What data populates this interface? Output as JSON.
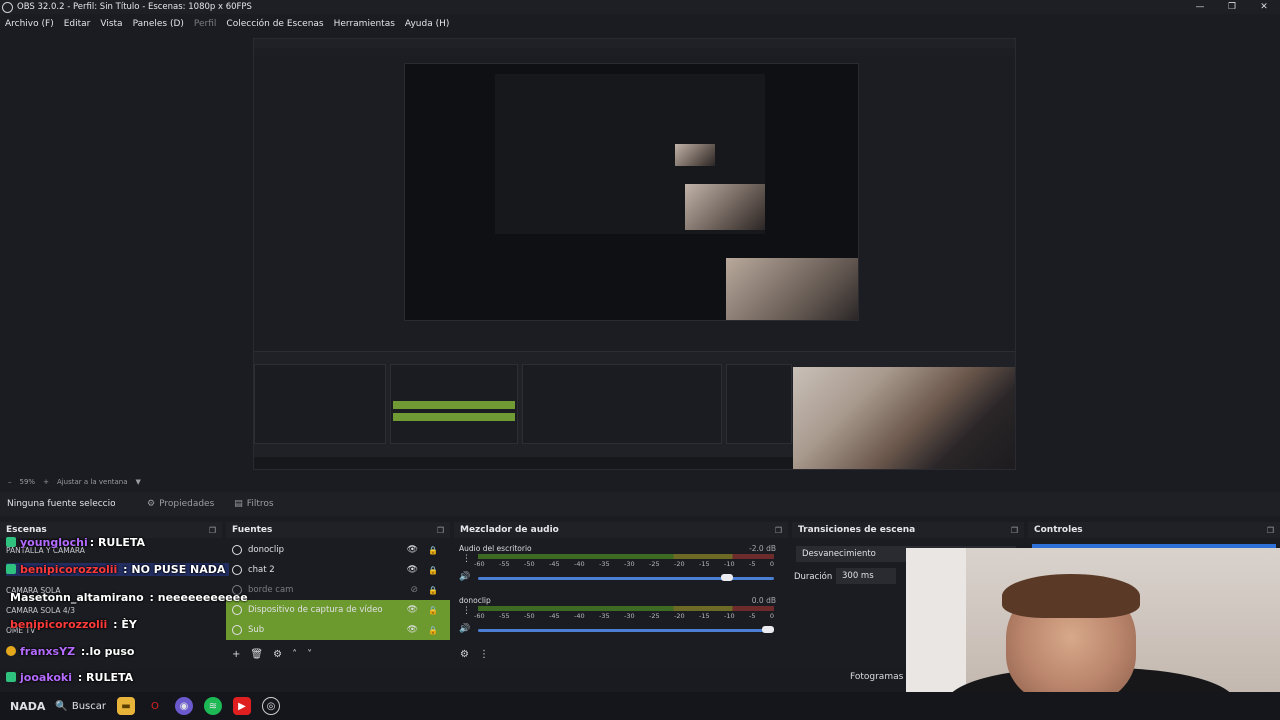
{
  "window": {
    "title": "OBS 32.0.2 - Perfil: Sin Título - Escenas: 1080p x 60FPS",
    "controls": [
      "—",
      "❐",
      "✕"
    ]
  },
  "menu": {
    "items": [
      {
        "label": "Archivo (F)",
        "disabled": false
      },
      {
        "label": "Editar",
        "disabled": false
      },
      {
        "label": "Vista",
        "disabled": false
      },
      {
        "label": "Paneles (D)",
        "disabled": false
      },
      {
        "label": "Perfil",
        "disabled": true
      },
      {
        "label": "Colección de Escenas",
        "disabled": false
      },
      {
        "label": "Herramientas",
        "disabled": false
      },
      {
        "label": "Ayuda (H)",
        "disabled": false
      }
    ]
  },
  "zoom": {
    "minus": "–",
    "value": "59%",
    "plus": "+",
    "fit": "Ajustar a la ventana",
    "dropdown": "▼"
  },
  "source_toolbar": {
    "no_source": "Ninguna fuente seleccionada",
    "properties": "Propiedades",
    "filters": "Filtros"
  },
  "docks": {
    "scenes": {
      "title": "Escenas",
      "items": [
        "PANTALLA Y CAMARA",
        "CAMARA SOLA",
        "CAMARA SOLA 4/3",
        "OME TV"
      ]
    },
    "sources": {
      "title": "Fuentes",
      "items": [
        {
          "name": "donoclip",
          "selected": false,
          "hidden": false
        },
        {
          "name": "chat 2",
          "selected": false,
          "hidden": false
        },
        {
          "name": "borde cam",
          "selected": false,
          "hidden": true
        },
        {
          "name": "Dispositivo de captura de vídeo",
          "selected": true,
          "hidden": false
        },
        {
          "name": "Sub",
          "selected": true,
          "hidden": false
        }
      ]
    },
    "mixer": {
      "title": "Mezclador de audio",
      "scale": [
        "-60",
        "-55",
        "-50",
        "-45",
        "-40",
        "-35",
        "-30",
        "-25",
        "-20",
        "-15",
        "-10",
        "-5",
        "0"
      ],
      "channels": [
        {
          "name": "Audio del escritorio",
          "db": "-2.0 dB",
          "level": 0.86
        },
        {
          "name": "donoclip",
          "db": "0.0 dB",
          "level": 1.0
        }
      ]
    },
    "transitions": {
      "title": "Transiciones de escena",
      "selected": "Desvanecimiento",
      "duration_label": "Duración",
      "duration_value": "300 ms"
    },
    "controls": {
      "title": "Controles"
    }
  },
  "status": {
    "fps_label": "Fotogramas P"
  },
  "chat": [
    {
      "user": "younglochi",
      "msg": ": RULETA",
      "badge": "green",
      "user_color": "#b46bff"
    },
    {
      "user": "benipicorozzolii",
      "msg": " : NO PUSE NADA",
      "badge": "green",
      "user_color": "#ff3a3a"
    },
    {
      "user": "Masetonn_altamirano",
      "msg": " : neeeeeeeeeee",
      "badge": "",
      "user_color": "#ffffff"
    },
    {
      "user": "benipicorozzolii",
      "msg": " : ÈY",
      "badge": "",
      "user_color": "#ff3a3a"
    },
    {
      "user": "franxsYZ",
      "msg": " :.lo puso",
      "badge": "gold",
      "user_color": "#b46bff"
    },
    {
      "user": "jooakoki",
      "msg": " : RULETA",
      "badge": "green",
      "user_color": "#b46bff"
    }
  ],
  "taskbar": {
    "start_text": "NADA",
    "search_label": "Buscar"
  },
  "colors": {
    "accent_green": "#6c9a2f",
    "accent_blue": "#2f6fd8",
    "background": "#1b1c21"
  }
}
